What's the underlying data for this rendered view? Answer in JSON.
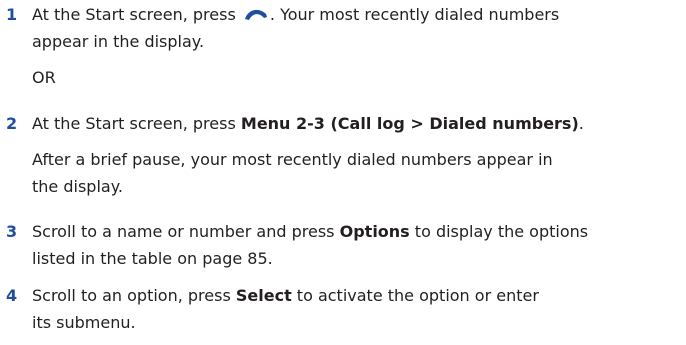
{
  "steps": [
    {
      "number": "1",
      "text_before_icon": "At the Start screen, press ",
      "icon": "send-key-icon",
      "text_after_icon": ". Your most recently dialed numbers",
      "line2": "appear in the display."
    },
    {
      "or_label": "OR"
    },
    {
      "number": "2",
      "text_a": "At the Start screen, press ",
      "bold_a": "Menu 2-3 (Call log > Dialed numbers)",
      "text_b": ".",
      "note_line1": "After a brief pause, your most recently dialed numbers appear in",
      "note_line2": "the display."
    },
    {
      "number": "3",
      "text_a": "Scroll to a name or number and press ",
      "bold_a": "Options",
      "text_b": " to display the options",
      "line2": "listed in the table on page 85."
    },
    {
      "number": "4",
      "text_a": "Scroll to an option, press ",
      "bold_a": "Select",
      "text_b": " to activate the option or enter",
      "line2": "its submenu."
    }
  ],
  "colors": {
    "step_number": "#1f4e9c",
    "icon": "#1f4e9c",
    "text": "#231f20"
  }
}
